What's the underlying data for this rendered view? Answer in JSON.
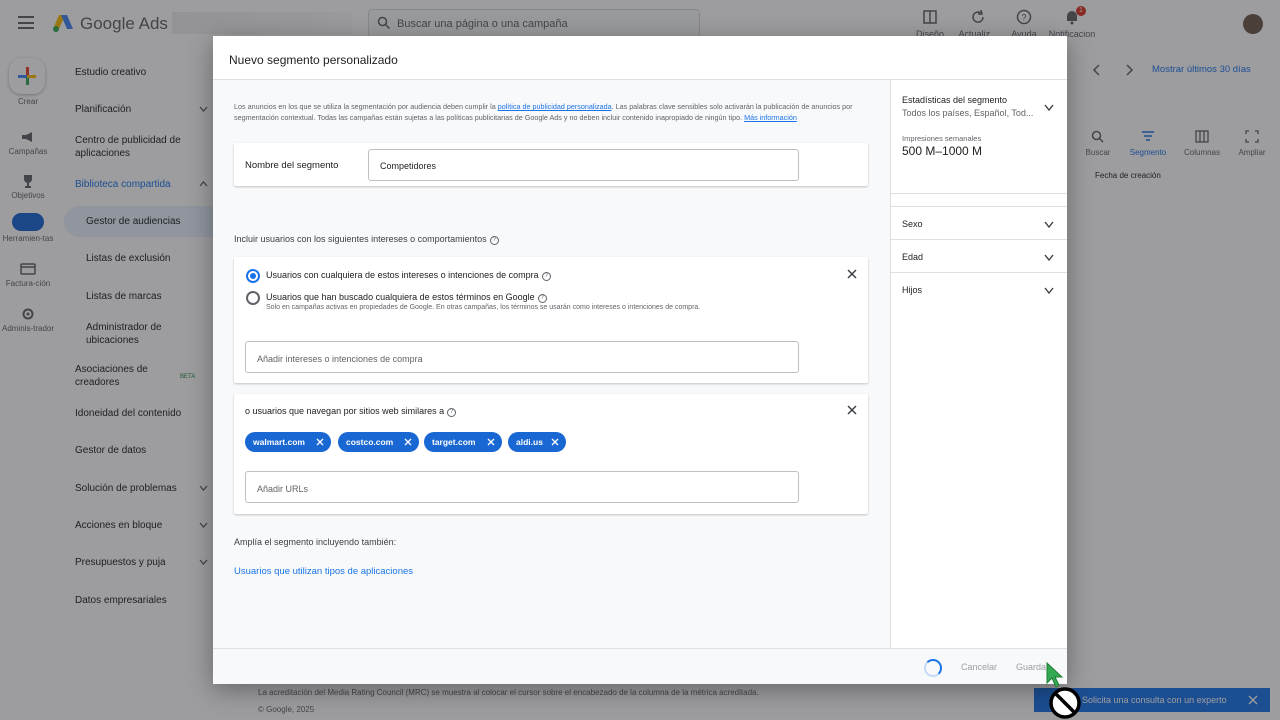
{
  "app": {
    "brand": "Google Ads",
    "search_placeholder": "Buscar una página o una campaña",
    "top_actions": [
      "Diseño",
      "Actualiz...",
      "Ayuda",
      "Notificacion"
    ],
    "notif_count": "1"
  },
  "rail": {
    "create": "Crear",
    "items": [
      "Campañas",
      "Objetivos",
      "Herramien-tas",
      "Factura-ción",
      "Adminis-trador"
    ]
  },
  "sidebar": {
    "items": [
      "Estudio creativo",
      "Planificación",
      "Centro de publicidad de aplicaciones",
      "Biblioteca compartida",
      "Gestor de audiencias",
      "Listas de exclusión",
      "Listas de marcas",
      "Administrador de ubicaciones",
      "Asociaciones de creadores",
      "Idoneidad del contenido",
      "Gestor de datos",
      "Solución de problemas",
      "Acciones en bloque",
      "Presupuestos y puja",
      "Datos empresariales"
    ],
    "beta": "BETA"
  },
  "background": {
    "date_range": "Mostrar últimos 30 días",
    "toolbar": [
      "Buscar",
      "Segmento",
      "Columnas",
      "Ampliar"
    ],
    "column_header": "Fecha de creación",
    "footer_mrc": "La acreditación del Media Rating Council (MRC) se muestra al colocar el cursor sobre el encabezado de la columna de la métrica acreditada.",
    "footer_copy": "© Google, 2025",
    "expert_bar": "Solicita una consulta con un experto"
  },
  "dialog": {
    "title": "Nuevo segmento personalizado",
    "notice_pre": "Los anuncios en los que se utiliza la segmentación por audiencia deben cumplir la ",
    "notice_link": "política de publicidad personalizada",
    "notice_post": ". Las palabras clave sensibles solo activarán la publicación de anuncios por segmentación contextual. Todas las campañas están sujetas a las políticas publicitarias de Google Ads y no deben incluir contenido inapropiado de ningún tipo. ",
    "notice_more": "Más información",
    "segment_name_label": "Nombre del segmento",
    "segment_name_value": "Competidores",
    "include_label": "Incluir usuarios con los siguientes intereses o comportamientos",
    "radio_interests": "Usuarios con cualquiera de estos intereses o intenciones de compra",
    "radio_searched": "Usuarios que han buscado cualquiera de estos términos en Google",
    "radio_searched_note": "Solo en campañas activas en propiedades de Google. En otras campañas, los términos se usarán como intereses o intenciones de compra.",
    "interests_placeholder": "Añadir intereses o intenciones de compra",
    "sites_label": "o usuarios que navegan por sitios web similares a",
    "url_chips": [
      "walmart.com",
      "costco.com",
      "target.com",
      "aldi.us"
    ],
    "urls_placeholder": "Añadir URLs",
    "expand_label": "Amplía el segmento incluyendo también:",
    "apps_link": "Usuarios que utilizan tipos de aplicaciones",
    "cancel": "Cancelar",
    "save": "Guardar"
  },
  "stats": {
    "title": "Estadísticas del segmento",
    "subtitle": "Todos los países, Español, Tod...",
    "impressions_label": "Impresiones semanales",
    "impressions_value": "500 M–1000 M",
    "sections": [
      "Sexo",
      "Edad",
      "Hijos"
    ]
  },
  "colors": {
    "accent": "#1a73e8",
    "chip": "#1967d2",
    "scrim": "rgba(32,33,36,0.44)"
  }
}
